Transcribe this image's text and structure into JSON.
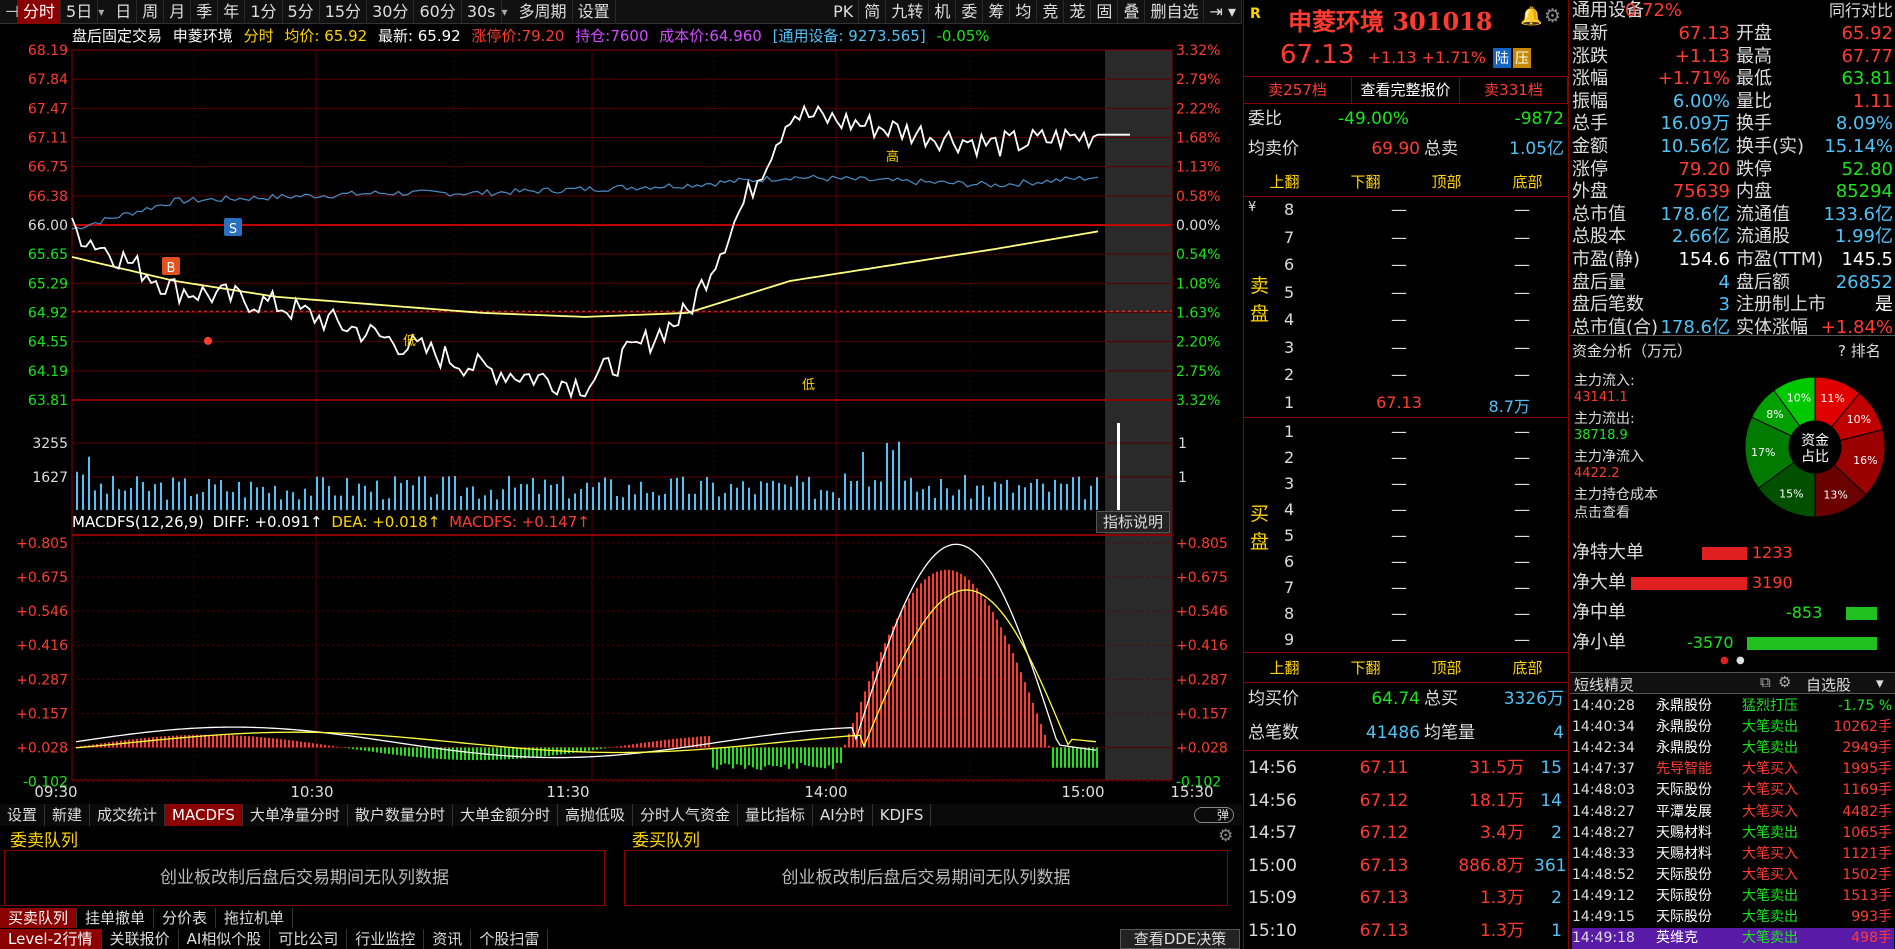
{
  "toolbar": {
    "items": [
      "分时",
      "5日",
      "日",
      "周",
      "月",
      "季",
      "年",
      "1分",
      "5分",
      "15分",
      "30分",
      "60分",
      "30s",
      "多周期",
      "设置"
    ],
    "right_items": [
      "PK",
      "简",
      "九转",
      "机",
      "委",
      "筹",
      "均",
      "竞",
      "茏",
      "固",
      "叠",
      "删自选"
    ]
  },
  "infobar": {
    "session": "盘后固定交易",
    "name": "申菱环境",
    "mode": "分时",
    "avg": "均价: 65.92",
    "latest": "最新: 65.92",
    "limit_up": "涨停价:79.20",
    "position": "持仓:7600",
    "cost": "成本价:64.960",
    "sector": "[通用设备: 9273.565]",
    "sector_change": "-0.05%"
  },
  "price_axis": [
    "68.19",
    "67.84",
    "67.47",
    "67.11",
    "66.75",
    "66.38",
    "66.00",
    "65.65",
    "65.29",
    "64.92",
    "64.55",
    "64.19",
    "63.81"
  ],
  "pct_axis": [
    "3.32%",
    "2.79%",
    "2.22%",
    "1.68%",
    "1.13%",
    "0.58%",
    "0.00%",
    "0.54%",
    "1.08%",
    "1.63%",
    "2.20%",
    "2.75%",
    "3.32%"
  ],
  "volume_axis": [
    "3255",
    "1627"
  ],
  "volume_axis_right": [
    "1",
    "1"
  ],
  "macd_axis": [
    "+0.805",
    "+0.675",
    "+0.546",
    "+0.416",
    "+0.287",
    "+0.157",
    "+0.028",
    "-0.102"
  ],
  "time_axis": [
    "09:30",
    "10:30",
    "11:30",
    "14:00",
    "15:00",
    "15:30"
  ],
  "markers": {
    "buy": "B",
    "sell": "S",
    "low": "低",
    "high": "高"
  },
  "macd": {
    "name": "MACDFS(12,26,9)",
    "diff": "DIFF: +0.091↑",
    "dea": "DEA: +0.018↑",
    "macdfs": "MACDFS: +0.147↑",
    "explain": "指标说明"
  },
  "indicator_tabs": [
    "设置",
    "新建",
    "成交统计",
    "MACDFS",
    "大单净量分时",
    "散户数量分时",
    "大单金额分时",
    "高抛低吸",
    "分时人气资金",
    "量比指标",
    "AI分时",
    "KDJFS"
  ],
  "queues": {
    "sell_title": "委卖队列",
    "buy_title": "委买队列",
    "sell_msg": "创业板改制后盘后交易期间无队列数据",
    "buy_msg": "创业板改制后盘后交易期间无队列数据"
  },
  "bottom_tabs1": [
    "买卖队列",
    "挂单撤单",
    "分价表",
    "拖拉机单"
  ],
  "bottom_tabs2": [
    "Level-2行情",
    "关联报价",
    "AI相似个股",
    "可比公司",
    "行业监控",
    "资讯",
    "个股扫雷"
  ],
  "dde_button": "查看DDE决策",
  "quote": {
    "name": "申菱环境",
    "code": "301018",
    "price": "67.13",
    "change": "+1.13",
    "change_pct": "+1.71%",
    "tag1": "陆",
    "tag2": "压",
    "btn_sell_levels": "卖257档",
    "btn_full": "查看完整报价",
    "btn_buy_levels": "卖331档",
    "weibi_label": "委比",
    "weibi": "-49.00%",
    "weicha": "-9872",
    "avg_sell_label": "均卖价",
    "avg_sell": "69.90",
    "total_sell_label": "总卖",
    "total_sell": "1.05亿",
    "nav": [
      "上翻",
      "下翻",
      "顶部",
      "底部"
    ],
    "sell_side_label": "卖盘",
    "buy_side_label": "买盘",
    "sell_levels": [
      {
        "n": "8",
        "p": "—",
        "q": "—"
      },
      {
        "n": "7",
        "p": "—",
        "q": "—"
      },
      {
        "n": "6",
        "p": "—",
        "q": "—"
      },
      {
        "n": "5",
        "p": "—",
        "q": "—"
      },
      {
        "n": "4",
        "p": "—",
        "q": "—"
      },
      {
        "n": "3",
        "p": "—",
        "q": "—"
      },
      {
        "n": "2",
        "p": "—",
        "q": "—"
      },
      {
        "n": "1",
        "p": "67.13",
        "q": "8.7万"
      }
    ],
    "buy_levels": [
      {
        "n": "1",
        "p": "—",
        "q": "—"
      },
      {
        "n": "2",
        "p": "—",
        "q": "—"
      },
      {
        "n": "3",
        "p": "—",
        "q": "—"
      },
      {
        "n": "4",
        "p": "—",
        "q": "—"
      },
      {
        "n": "5",
        "p": "—",
        "q": "—"
      },
      {
        "n": "6",
        "p": "—",
        "q": "—"
      },
      {
        "n": "7",
        "p": "—",
        "q": "—"
      },
      {
        "n": "8",
        "p": "—",
        "q": "—"
      },
      {
        "n": "9",
        "p": "—",
        "q": "—"
      }
    ],
    "avg_buy_label": "均买价",
    "avg_buy": "64.74",
    "total_buy_label": "总买",
    "total_buy": "3326万",
    "total_trades_label": "总笔数",
    "total_trades": "41486",
    "avg_trade_label": "均笔量",
    "avg_trade": "4",
    "trades": [
      {
        "t": "14:56",
        "p": "67.11",
        "q": "31.5万",
        "c": "15"
      },
      {
        "t": "14:56",
        "p": "67.12",
        "q": "18.1万",
        "c": "14"
      },
      {
        "t": "14:57",
        "p": "67.12",
        "q": "3.4万",
        "c": "2"
      },
      {
        "t": "15:00",
        "p": "67.13",
        "q": "886.8万",
        "c": "361"
      },
      {
        "t": "15:09",
        "p": "67.13",
        "q": "1.3万",
        "c": "2"
      },
      {
        "t": "15:10",
        "p": "67.13",
        "q": "1.3万",
        "c": "1"
      }
    ]
  },
  "stats": {
    "header_left": "通用设备",
    "header_pct": "0.72%",
    "header_right": "同行对比",
    "rows": [
      {
        "l": "最新",
        "lv": "67.13",
        "lc": "red",
        "r": "开盘",
        "rv": "65.92",
        "rc": "red"
      },
      {
        "l": "涨跌",
        "lv": "+1.13",
        "lc": "red",
        "r": "最高",
        "rv": "67.77",
        "rc": "red"
      },
      {
        "l": "涨幅",
        "lv": "+1.71%",
        "lc": "red",
        "r": "最低",
        "rv": "63.81",
        "rc": "green"
      },
      {
        "l": "振幅",
        "lv": "6.00%",
        "lc": "cyan",
        "r": "量比",
        "rv": "1.11",
        "rc": "red"
      },
      {
        "l": "总手",
        "lv": "16.09万",
        "lc": "cyan",
        "r": "换手",
        "rv": "8.09%",
        "rc": "cyan"
      },
      {
        "l": "金额",
        "lv": "10.56亿",
        "lc": "cyan",
        "r": "换手(实)",
        "rv": "15.14%",
        "rc": "cyan"
      },
      {
        "l": "涨停",
        "lv": "79.20",
        "lc": "red",
        "r": "跌停",
        "rv": "52.80",
        "rc": "green"
      },
      {
        "l": "外盘",
        "lv": "75639",
        "lc": "red",
        "r": "内盘",
        "rv": "85294",
        "rc": "green"
      },
      {
        "l": "总市值",
        "lv": "178.6亿",
        "lc": "cyan",
        "r": "流通值",
        "rv": "133.6亿",
        "rc": "cyan"
      },
      {
        "l": "总股本",
        "lv": "2.66亿",
        "lc": "cyan",
        "r": "流通股",
        "rv": "1.99亿",
        "rc": "cyan"
      },
      {
        "l": "市盈(静)",
        "lv": "154.6",
        "lc": "white",
        "r": "市盈(TTM)",
        "rv": "145.5",
        "rc": "white"
      },
      {
        "l": "盘后量",
        "lv": "4",
        "lc": "cyan",
        "r": "盘后额",
        "rv": "26852",
        "rc": "cyan"
      },
      {
        "l": "盘后笔数",
        "lv": "3",
        "lc": "cyan",
        "r": "注册制上市",
        "rv": "是",
        "rc": "white"
      },
      {
        "l": "总市值(合)",
        "lv": "178.6亿",
        "lc": "cyan",
        "r": "实体涨幅",
        "rv": "+1.84%",
        "rc": "red"
      }
    ],
    "fund_title": "资金分析（万元）",
    "fund_more": "? 排名",
    "main_in_label": "主力流入:",
    "main_in": "43141.1",
    "main_out_label": "主力流出:",
    "main_out": "38718.9",
    "main_net_label": "主力净流入",
    "main_net": "4422.2",
    "main_cost_label": "主力持仓成本",
    "main_cost_link": "点击查看",
    "pie_center": [
      "资金",
      "占比"
    ],
    "pie": [
      {
        "label": "11%",
        "value": 11,
        "color": "#e00000"
      },
      {
        "label": "10%",
        "value": 10,
        "color": "#c00000"
      },
      {
        "label": "16%",
        "value": 16,
        "color": "#9a0000"
      },
      {
        "label": "13%",
        "value": 13,
        "color": "#6a0000"
      },
      {
        "label": "15%",
        "value": 15,
        "color": "#005000"
      },
      {
        "label": "17%",
        "value": 17,
        "color": "#007a00"
      },
      {
        "label": "8%",
        "value": 8,
        "color": "#00a000"
      },
      {
        "label": "10%",
        "value": 10,
        "color": "#00c800"
      }
    ],
    "net": [
      {
        "l": "净特大单",
        "v": "1233",
        "color": "#e02020",
        "bar": 1233
      },
      {
        "l": "净大单",
        "v": "3190",
        "color": "#e02020",
        "bar": 3190
      },
      {
        "l": "净中单",
        "v": "-853",
        "color": "#20c020",
        "bar": -853
      },
      {
        "l": "净小单",
        "v": "-3570",
        "color": "#20c020",
        "bar": -3570
      }
    ],
    "sprite_title": "短线精灵",
    "sprite_filter": "自选股",
    "sprite": [
      {
        "t": "14:40:28",
        "n": "永鼎股份",
        "e": "猛烈打压",
        "ec": "green",
        "v": "-1.75 %",
        "vc": "green"
      },
      {
        "t": "14:40:34",
        "n": "永鼎股份",
        "e": "大笔卖出",
        "ec": "green",
        "v": "10262手",
        "vc": "red"
      },
      {
        "t": "14:42:34",
        "n": "永鼎股份",
        "e": "大笔卖出",
        "ec": "green",
        "v": "2949手",
        "vc": "red"
      },
      {
        "t": "14:47:37",
        "n": "先导智能",
        "e": "大笔买入",
        "ec": "red",
        "v": "1995手",
        "vc": "red",
        "nc": "red"
      },
      {
        "t": "14:48:03",
        "n": "天际股份",
        "e": "大笔买入",
        "ec": "red",
        "v": "1169手",
        "vc": "red"
      },
      {
        "t": "14:48:27",
        "n": "平潭发展",
        "e": "大笔买入",
        "ec": "red",
        "v": "4482手",
        "vc": "red"
      },
      {
        "t": "14:48:27",
        "n": "天赐材料",
        "e": "大笔卖出",
        "ec": "green",
        "v": "1065手",
        "vc": "red"
      },
      {
        "t": "14:48:33",
        "n": "天赐材料",
        "e": "大笔买入",
        "ec": "red",
        "v": "1121手",
        "vc": "red"
      },
      {
        "t": "14:48:52",
        "n": "天际股份",
        "e": "大笔买入",
        "ec": "red",
        "v": "1502手",
        "vc": "red"
      },
      {
        "t": "14:49:12",
        "n": "天际股份",
        "e": "大笔卖出",
        "ec": "green",
        "v": "1513手",
        "vc": "red"
      },
      {
        "t": "14:49:15",
        "n": "天际股份",
        "e": "大笔卖出",
        "ec": "green",
        "v": "993手",
        "vc": "red"
      },
      {
        "t": "14:49:18",
        "n": "英维克",
        "e": "大笔卖出",
        "ec": "green",
        "v": "498手",
        "vc": "red",
        "highlight": true
      }
    ]
  },
  "chart_data": {
    "type": "line",
    "title": "申菱环境 分时",
    "prev_close": 66.0,
    "ylim": [
      63.81,
      68.19
    ],
    "x": [
      "09:30",
      "10:00",
      "10:30",
      "11:00",
      "11:30",
      "13:30",
      "14:00",
      "14:15",
      "14:30",
      "14:45",
      "15:00"
    ],
    "series": [
      {
        "name": "最新",
        "values": [
          65.95,
          65.2,
          65.0,
          64.6,
          64.2,
          64.0,
          64.9,
          67.4,
          67.2,
          67.0,
          67.13
        ]
      },
      {
        "name": "均价",
        "values": [
          65.6,
          65.3,
          65.1,
          65.0,
          64.9,
          64.85,
          64.9,
          65.3,
          65.5,
          65.7,
          65.92
        ]
      },
      {
        "name": "通用设备",
        "values": [
          65.95,
          66.3,
          66.35,
          66.4,
          66.4,
          66.45,
          66.5,
          66.6,
          66.55,
          66.5,
          66.6
        ]
      }
    ]
  }
}
